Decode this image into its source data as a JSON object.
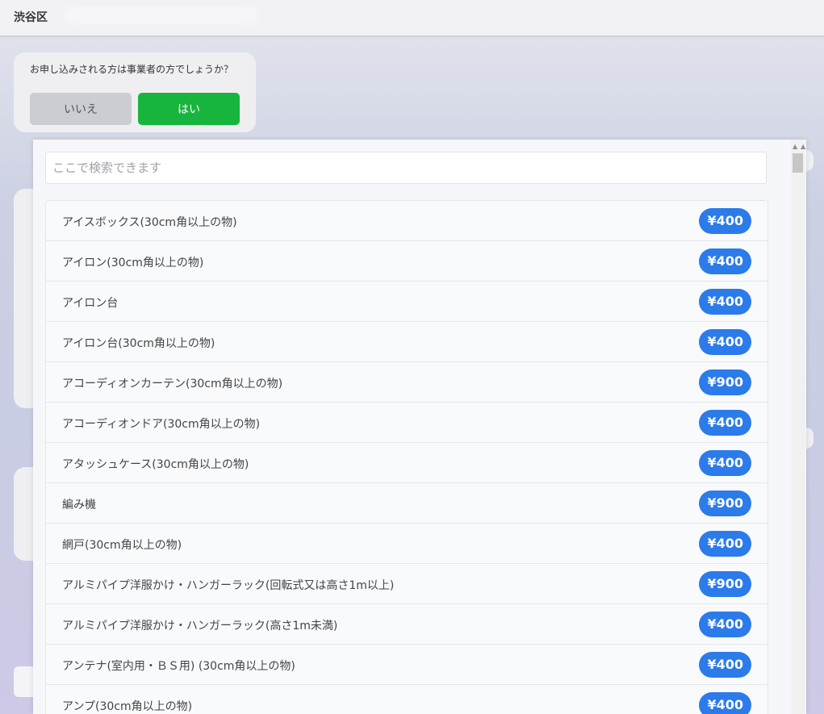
{
  "header": {
    "title": "渋谷区"
  },
  "question": {
    "text": "お申し込みされる方は事業者の方でしょうか？",
    "no_label": "いいえ",
    "yes_label": "はい"
  },
  "search": {
    "placeholder": "ここで検索できます",
    "value": ""
  },
  "items": [
    {
      "name": "アイスボックス(30cm角以上の物)",
      "price": "¥400"
    },
    {
      "name": "アイロン(30cm角以上の物)",
      "price": "¥400"
    },
    {
      "name": "アイロン台",
      "price": "¥400"
    },
    {
      "name": "アイロン台(30cm角以上の物)",
      "price": "¥400"
    },
    {
      "name": "アコーディオンカーテン(30cm角以上の物)",
      "price": "¥900"
    },
    {
      "name": "アコーディオンドア(30cm角以上の物)",
      "price": "¥400"
    },
    {
      "name": "アタッシュケース(30cm角以上の物)",
      "price": "¥400"
    },
    {
      "name": "編み機",
      "price": "¥900"
    },
    {
      "name": "網戸(30cm角以上の物)",
      "price": "¥400"
    },
    {
      "name": "アルミパイプ洋服かけ・ハンガーラック(回転式又は高さ1m以上)",
      "price": "¥900"
    },
    {
      "name": "アルミパイプ洋服かけ・ハンガーラック(高さ1m未満)",
      "price": "¥400"
    },
    {
      "name": "アンテナ(室内用・ＢＳ用) (30cm角以上の物)",
      "price": "¥400"
    },
    {
      "name": "アンプ(30cm角以上の物)",
      "price": "¥400"
    }
  ],
  "colors": {
    "accent_green": "#17b53e",
    "price_blue": "#2b7bea"
  }
}
